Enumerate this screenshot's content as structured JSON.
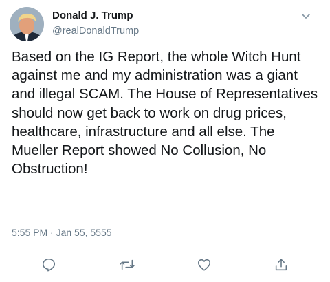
{
  "tweet": {
    "author": {
      "display_name": "Donald J. Trump",
      "handle": "@realDonaldTrump"
    },
    "text": "Based on the IG Report, the whole Witch Hunt against me and my administration was a giant and illegal SCAM. The House of Representatives should now get back to work on drug prices, healthcare, infrastructure and all else. The Mueller Report showed No Collusion, No Obstruction!",
    "timestamp": "5:55 PM · Jan 55, 5555"
  },
  "actions": {
    "icons": [
      "reply-icon",
      "retweet-icon",
      "like-icon",
      "share-icon"
    ]
  },
  "colors": {
    "primary_text": "#14171a",
    "secondary_text": "#657786",
    "divider": "#e6ecf0"
  }
}
